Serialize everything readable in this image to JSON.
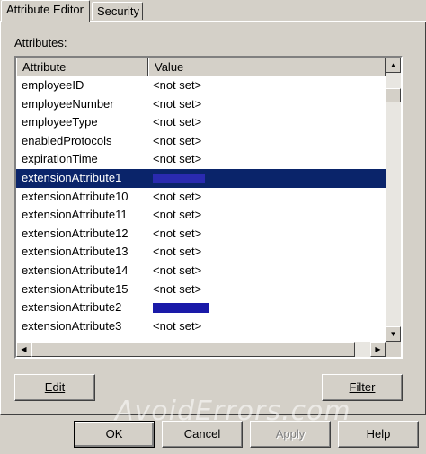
{
  "tabs": [
    {
      "label": "Attribute Editor",
      "active": true
    },
    {
      "label": "Security",
      "active": false
    }
  ],
  "attributes_label": "Attributes:",
  "columns": {
    "attribute": "Attribute",
    "value": "Value"
  },
  "rows": [
    {
      "attribute": "employeeID",
      "value": "<not set>"
    },
    {
      "attribute": "employeeNumber",
      "value": "<not set>"
    },
    {
      "attribute": "employeeType",
      "value": "<not set>"
    },
    {
      "attribute": "enabledProtocols",
      "value": "<not set>"
    },
    {
      "attribute": "expirationTime",
      "value": "<not set>"
    },
    {
      "attribute": "extensionAttribute1",
      "value": "",
      "selected": true,
      "redacted": true
    },
    {
      "attribute": "extensionAttribute10",
      "value": "<not set>"
    },
    {
      "attribute": "extensionAttribute11",
      "value": "<not set>"
    },
    {
      "attribute": "extensionAttribute12",
      "value": "<not set>"
    },
    {
      "attribute": "extensionAttribute13",
      "value": "<not set>"
    },
    {
      "attribute": "extensionAttribute14",
      "value": "<not set>"
    },
    {
      "attribute": "extensionAttribute15",
      "value": "<not set>"
    },
    {
      "attribute": "extensionAttribute2",
      "value": "",
      "redacted": true
    },
    {
      "attribute": "extensionAttribute3",
      "value": "<not set>"
    }
  ],
  "buttons": {
    "edit": "Edit",
    "filter": "Filter",
    "ok": "OK",
    "cancel": "Cancel",
    "apply": "Apply",
    "help": "Help"
  },
  "watermark": "AvoidErrors.com",
  "colors": {
    "selection": "#0a246a",
    "face": "#d4d0c8",
    "redaction": "#1a1aa8"
  }
}
